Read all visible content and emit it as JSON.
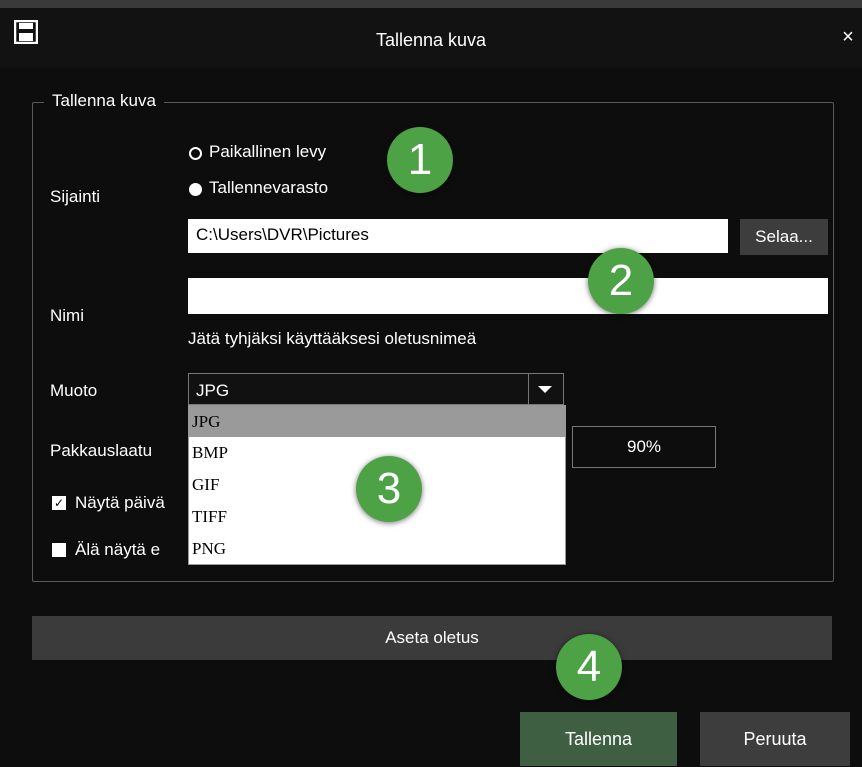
{
  "window": {
    "title": "Tallenna kuva",
    "icon": "save-icon",
    "close_symbol": "×"
  },
  "group": {
    "title": "Tallenna kuva"
  },
  "location": {
    "label": "Sijainti",
    "options": [
      "Paikallinen levy",
      "Tallennevarasto"
    ],
    "selected": "Tallennevarasto",
    "path": "C:\\Users\\DVR\\Pictures",
    "browse_label": "Selaa..."
  },
  "name": {
    "label": "Nimi",
    "value": "",
    "hint": "Jätä tyhjäksi käyttääksesi oletusnimeä"
  },
  "format": {
    "label": "Muoto",
    "selected": "JPG",
    "options": [
      "JPG",
      "BMP",
      "GIF",
      "TIFF",
      "PNG"
    ]
  },
  "quality": {
    "label": "Pakkauslaatu",
    "value": "90%"
  },
  "checkboxes": [
    {
      "label": "Näytä päivä",
      "checked": true
    },
    {
      "label": "Älä näytä e",
      "checked": false
    }
  ],
  "buttons": {
    "set_default": "Aseta oletus",
    "save": "Tallenna",
    "cancel": "Peruuta"
  },
  "badges": [
    "1",
    "2",
    "3",
    "4"
  ],
  "colors": {
    "background": "#0d0d0d",
    "button_gray": "#3d3d3d",
    "save_green": "#3f5f43",
    "badge_green": "#4da245",
    "dropdown_selected": "#9a9a9a"
  }
}
